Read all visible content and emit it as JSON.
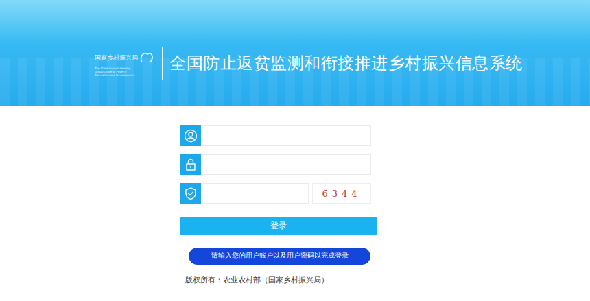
{
  "header": {
    "logo": {
      "name": "国家乡村振兴局",
      "english": "The State Council Leading Group Office of Poverty Alleviation and Development"
    },
    "title": "全国防止返贫监测和衔接推进乡村振兴信息系统"
  },
  "form": {
    "fields": [
      {
        "kind": "username"
      },
      {
        "kind": "password"
      },
      {
        "kind": "captcha",
        "captcha": "6344"
      }
    ],
    "login_button": "登录",
    "hint": "请输入您的用户账户以及用户密码以完成登录"
  },
  "copyright": "版权所有：农业农村部（国家乡村振兴局）"
}
